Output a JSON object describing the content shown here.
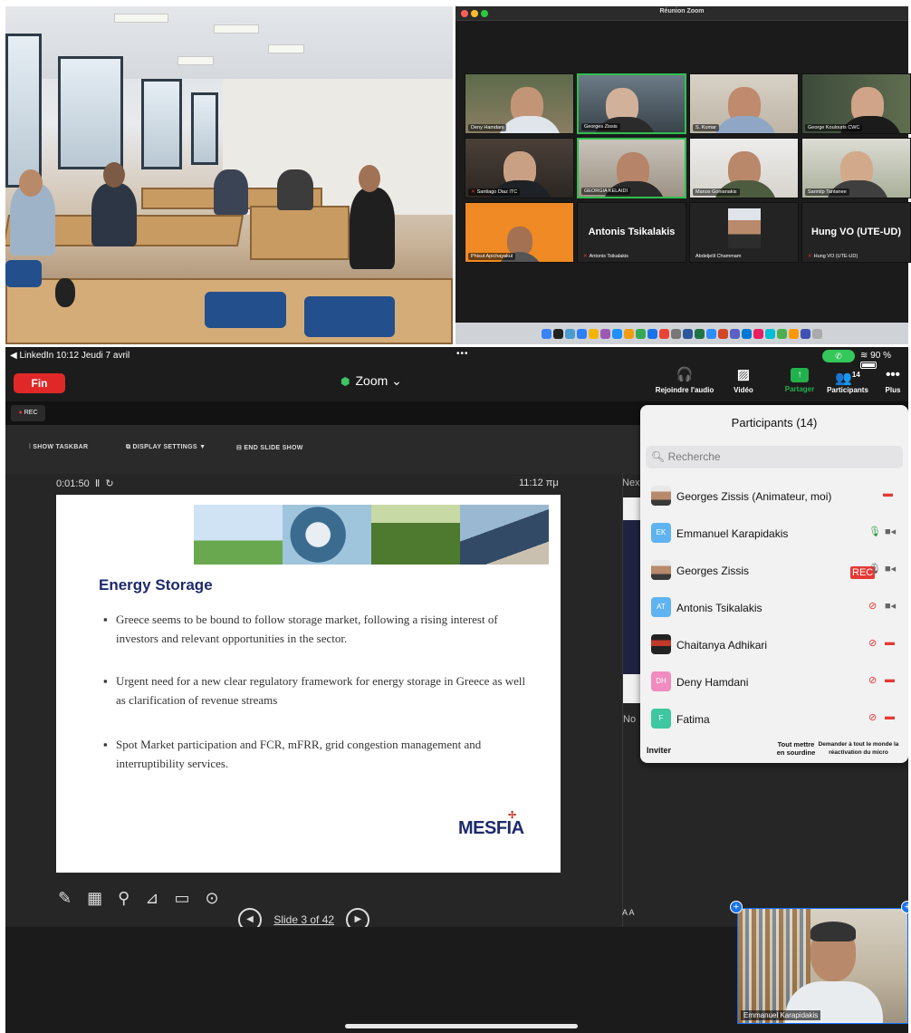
{
  "gallery": {
    "window_title": "Réunion Zoom",
    "tiles": [
      {
        "name": "Deny Hamdani"
      },
      {
        "name": "Georges Zissis"
      },
      {
        "name": "S. Kumar"
      },
      {
        "name": "George Koulouris CWC"
      },
      {
        "name": "Santiago Diaz ITC"
      },
      {
        "name": "GEORGIA KELAIDI"
      },
      {
        "name": "Manos Gonianakis"
      },
      {
        "name": "Sarintip Tantanee"
      },
      {
        "name": "Phisut Apichayakul"
      },
      {
        "name": "Antonis Tsikalakis",
        "display": "Antonis Tsikalakis"
      },
      {
        "name": "Abdeljelil Chammam"
      },
      {
        "name": "Hung VO (UTE-UD)",
        "display": "Hung VO (UTE-UD)"
      }
    ]
  },
  "status_bar": {
    "left": "◀ LinkedIn  10:12  Jeudi 7 avril",
    "battery": "90 %"
  },
  "toolbar": {
    "end_label": "Fin",
    "meeting_title": "Zoom",
    "audio_label": "Rejoindre l'audio",
    "video_label": "Vidéo",
    "share_label": "Partager",
    "participants_label": "Participants",
    "participants_count": "14",
    "more_label": "Plus"
  },
  "rec_label": "REC",
  "slideshow": {
    "show_taskbar": "SHOW TASKBAR",
    "display_settings": "DISPLAY SETTINGS ▼",
    "end_slide_show": "END SLIDE SHOW",
    "timer": "0:01:50",
    "clock": "11:12 πμ",
    "next_hint": "Nex",
    "notes_hint": "No",
    "slide_counter": "Slide 3 of 42",
    "font_controls": "A  A"
  },
  "slide": {
    "heading": "Energy Storage",
    "bullets": [
      "Greece seems to be bound to follow storage market, following a rising interest of investors and relevant opportunities in the sector.",
      "Urgent need for a new clear regulatory framework for energy storage in Greece as well as clarification of revenue streams",
      "Spot Market participation and FCR, mFRR, grid congestion management and interruptibility services."
    ],
    "logo_text": "MESFIA"
  },
  "participants_panel": {
    "title": "Participants (14)",
    "search_placeholder": "Recherche",
    "rows": [
      {
        "name": "Georges Zissis (Animateur, moi)",
        "initials": ""
      },
      {
        "name": "Emmanuel Karapidakis",
        "initials": "EK"
      },
      {
        "name": "Georges Zissis",
        "initials": "",
        "rec": "REC"
      },
      {
        "name": "Antonis Tsikalakis",
        "initials": "AT"
      },
      {
        "name": "Chaitanya Adhikari",
        "initials": ""
      },
      {
        "name": "Deny Hamdani",
        "initials": "DH"
      },
      {
        "name": "Fatima",
        "initials": "F"
      }
    ],
    "invite_label": "Inviter",
    "mute_all_label": "Tout mettre en sourdine",
    "ask_unmute_label": "Demander à tout le monde la réactivation du micro"
  },
  "self_view": {
    "name": "Emmanuel Karapidakis"
  },
  "colors": {
    "end_red": "#e02828",
    "share_green": "#23b14d",
    "active_speaker": "#2fbf4f",
    "slide_heading": "#1d2a6b"
  }
}
